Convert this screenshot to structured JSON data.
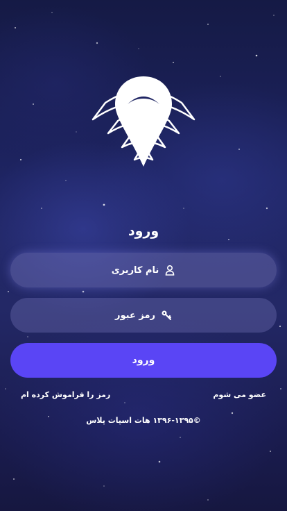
{
  "login": {
    "title": "ورود",
    "username_placeholder": "نام کاربری",
    "password_placeholder": "رمز عبور",
    "submit_label": "ورود",
    "signup_link": "عضو می شوم",
    "forgot_link": "رمز را فراموش کرده ام",
    "copyright": "©۱۳۹۶-۱۳۹۵ هات اسپات پلاس"
  },
  "icons": {
    "logo": "location-wifi-logo-icon",
    "username": "user-icon",
    "password": "key-icon"
  },
  "colors": {
    "primary_button": "#5a45f5",
    "background": "#1e2462",
    "field_bg": "rgba(120,120,190,0.35)",
    "text": "#ffffff"
  }
}
